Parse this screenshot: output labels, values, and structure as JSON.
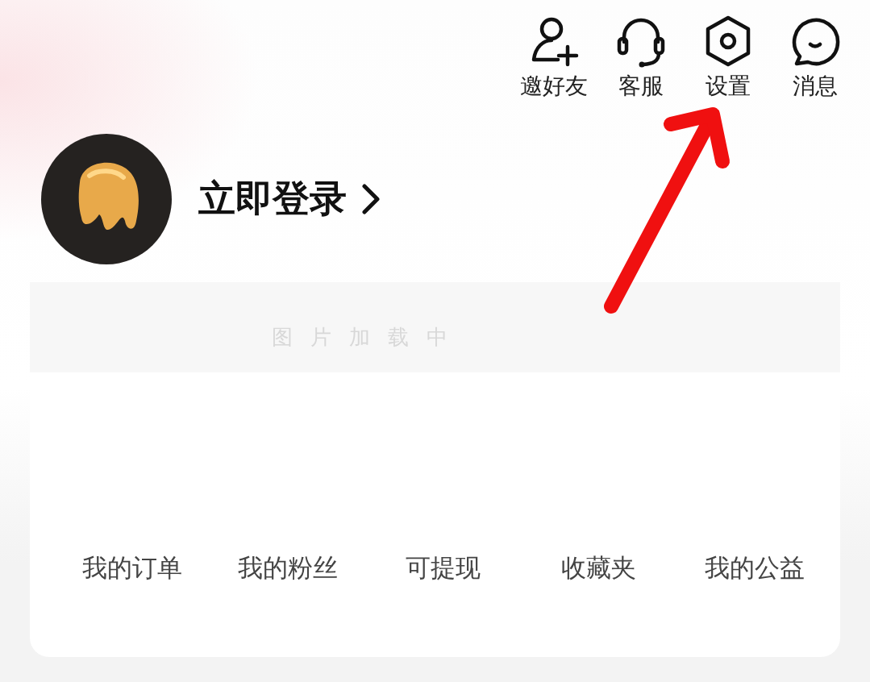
{
  "header_actions": [
    {
      "kind": "invite",
      "label": "邀好友"
    },
    {
      "kind": "service",
      "label": "客服"
    },
    {
      "kind": "settings",
      "label": "设置"
    },
    {
      "kind": "message",
      "label": "消息"
    }
  ],
  "login": {
    "label": "立即登录"
  },
  "banner": {
    "placeholder": "图片加载中"
  },
  "menu": [
    {
      "label": "我的订单"
    },
    {
      "label": "我的粉丝"
    },
    {
      "label": "可提现"
    },
    {
      "label": "收藏夹"
    },
    {
      "label": "我的公益"
    }
  ]
}
